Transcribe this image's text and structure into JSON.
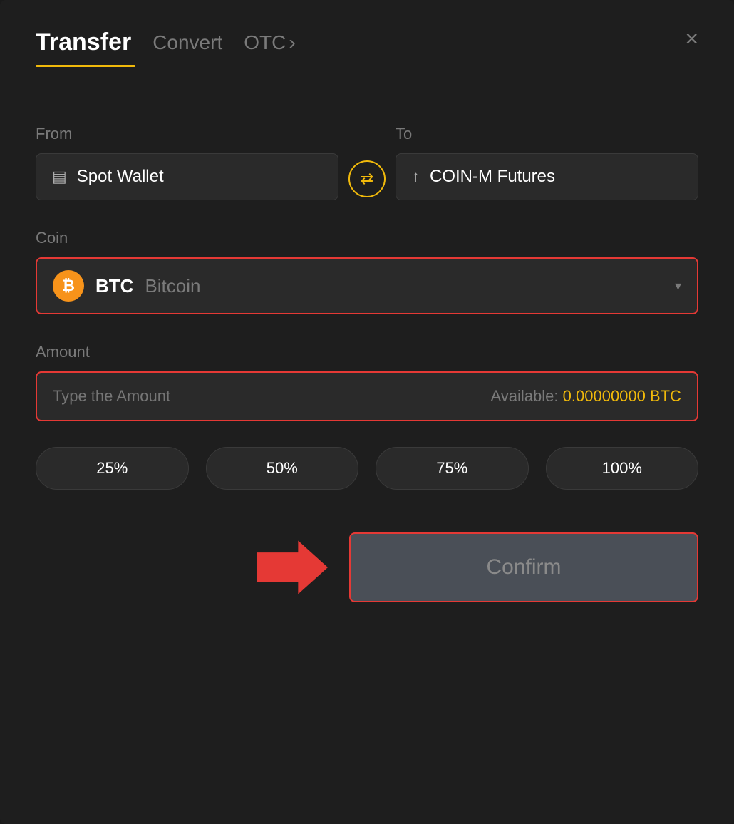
{
  "header": {
    "title": "Transfer",
    "tab_convert": "Convert",
    "tab_otc": "OTC",
    "tab_otc_chevron": "›",
    "close_label": "×"
  },
  "from": {
    "label": "From",
    "wallet_icon": "▤",
    "wallet_label": "Spot Wallet"
  },
  "swap": {
    "icon": "⇄"
  },
  "to": {
    "label": "To",
    "wallet_icon": "↑",
    "wallet_label": "COIN-M Futures"
  },
  "coin": {
    "label": "Coin",
    "symbol": "BTC",
    "name": "Bitcoin",
    "chevron": "▾"
  },
  "amount": {
    "label": "Amount",
    "placeholder": "Type the Amount",
    "available_label": "Available:",
    "available_value": "0.00000000 BTC"
  },
  "percent_buttons": [
    {
      "label": "25%",
      "value": "25"
    },
    {
      "label": "50%",
      "value": "50"
    },
    {
      "label": "75%",
      "value": "75"
    },
    {
      "label": "100%",
      "value": "100"
    }
  ],
  "confirm": {
    "label": "Confirm"
  }
}
